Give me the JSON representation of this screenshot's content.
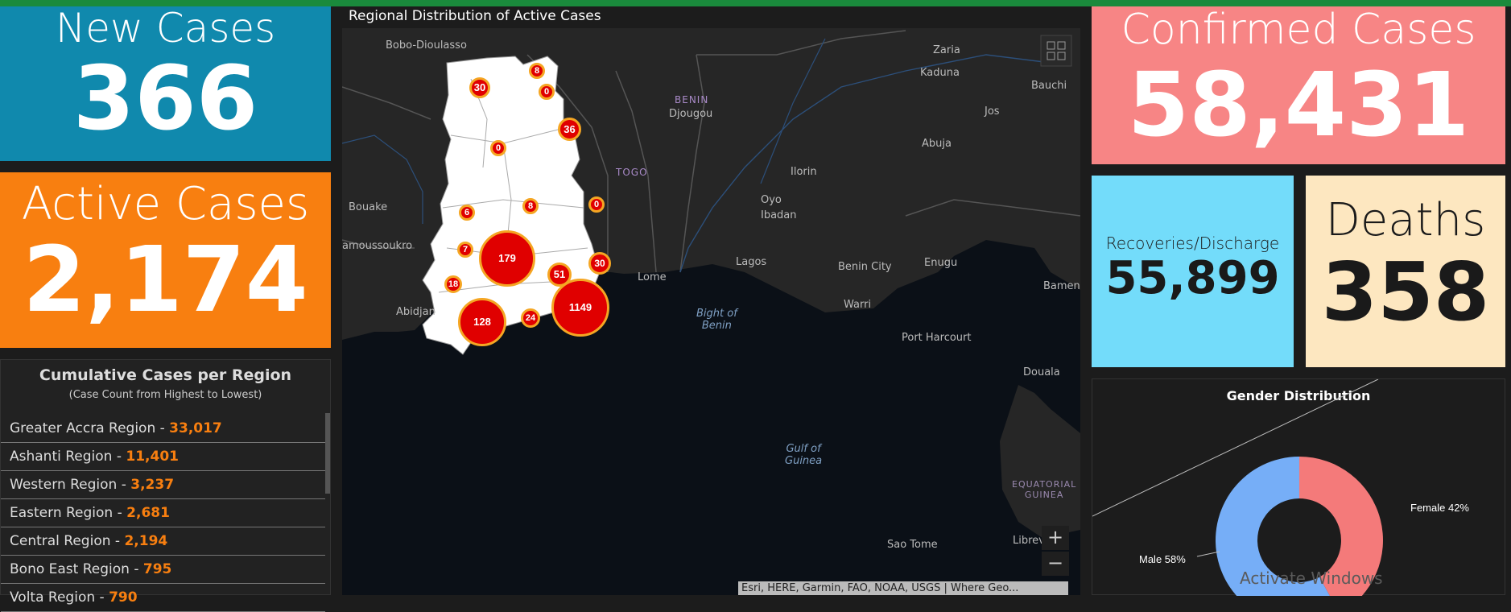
{
  "cards": {
    "new_cases": {
      "title": "New Cases",
      "value": "366"
    },
    "active_cases": {
      "title": "Active Cases",
      "value": "2,174"
    },
    "confirmed": {
      "title": "Confirmed Cases",
      "value": "58,431"
    },
    "recoveries": {
      "title": "Recoveries/Discharge",
      "value": "55,899"
    },
    "deaths": {
      "title": "Deaths",
      "value": "358"
    }
  },
  "regions": {
    "title": "Cumulative Cases per Region",
    "subtitle": "(Case Count from Highest to Lowest)",
    "items": [
      {
        "name": "Greater Accra Region - ",
        "count": "33,017"
      },
      {
        "name": "Ashanti Region - ",
        "count": "11,401"
      },
      {
        "name": "Western Region - ",
        "count": "3,237"
      },
      {
        "name": "Eastern Region - ",
        "count": "2,681"
      },
      {
        "name": "Central Region - ",
        "count": "2,194"
      },
      {
        "name": "Bono East Region - ",
        "count": "795"
      },
      {
        "name": "Volta Region - ",
        "count": "790"
      }
    ]
  },
  "map": {
    "title": "Regional Distribution of Active Cases",
    "attribution": "Esri, HERE, Garmin, FAO, NOAA, USGS | Where Geo...",
    "zoom_in": "+",
    "zoom_out": "−",
    "labels": {
      "bobo": "Bobo-Dioulasso",
      "zaria": "Zaria",
      "kaduna": "Kaduna",
      "bauchi": "Bauchi",
      "benin": "BENIN",
      "djougou": "Djougou",
      "jos": "Jos",
      "abuja": "Abuja",
      "togo": "TOGO",
      "ilorin": "Ilorin",
      "bouake": "Bouake",
      "oyo": "Oyo",
      "ibadan": "Ibadan",
      "yamoussoukro": "amoussoukro",
      "lagos": "Lagos",
      "benin_city": "Benin City",
      "enugu": "Enugu",
      "lome": "Lome",
      "bamenda": "Bamen",
      "abidjan": "Abidjan",
      "warri": "Warri",
      "bight": "Bight of\nBenin",
      "port_harcourt": "Port Harcourt",
      "douala": "Douala",
      "gulf": "Gulf of\nGuinea",
      "eq_guinea": "EQUATORIAL\nGUINEA",
      "libreville": "Librev",
      "sao_tome": "Sao Tome"
    },
    "clusters": [
      "30",
      "8",
      "0",
      "36",
      "0",
      "8",
      "6",
      "0",
      "7",
      "179",
      "18",
      "51",
      "30",
      "1149",
      "128",
      "24"
    ],
    "colors": {
      "cluster_fill": "#e00000",
      "cluster_ring": "#f5a623"
    }
  },
  "gender": {
    "title": "Gender Distribution",
    "female_label": "Female 42%",
    "male_label": "Male 58%",
    "female_pct": 42,
    "male_pct": 58,
    "female_color": "#f47a7a",
    "male_color": "#76aef7"
  },
  "watermark": "Activate Windows"
}
